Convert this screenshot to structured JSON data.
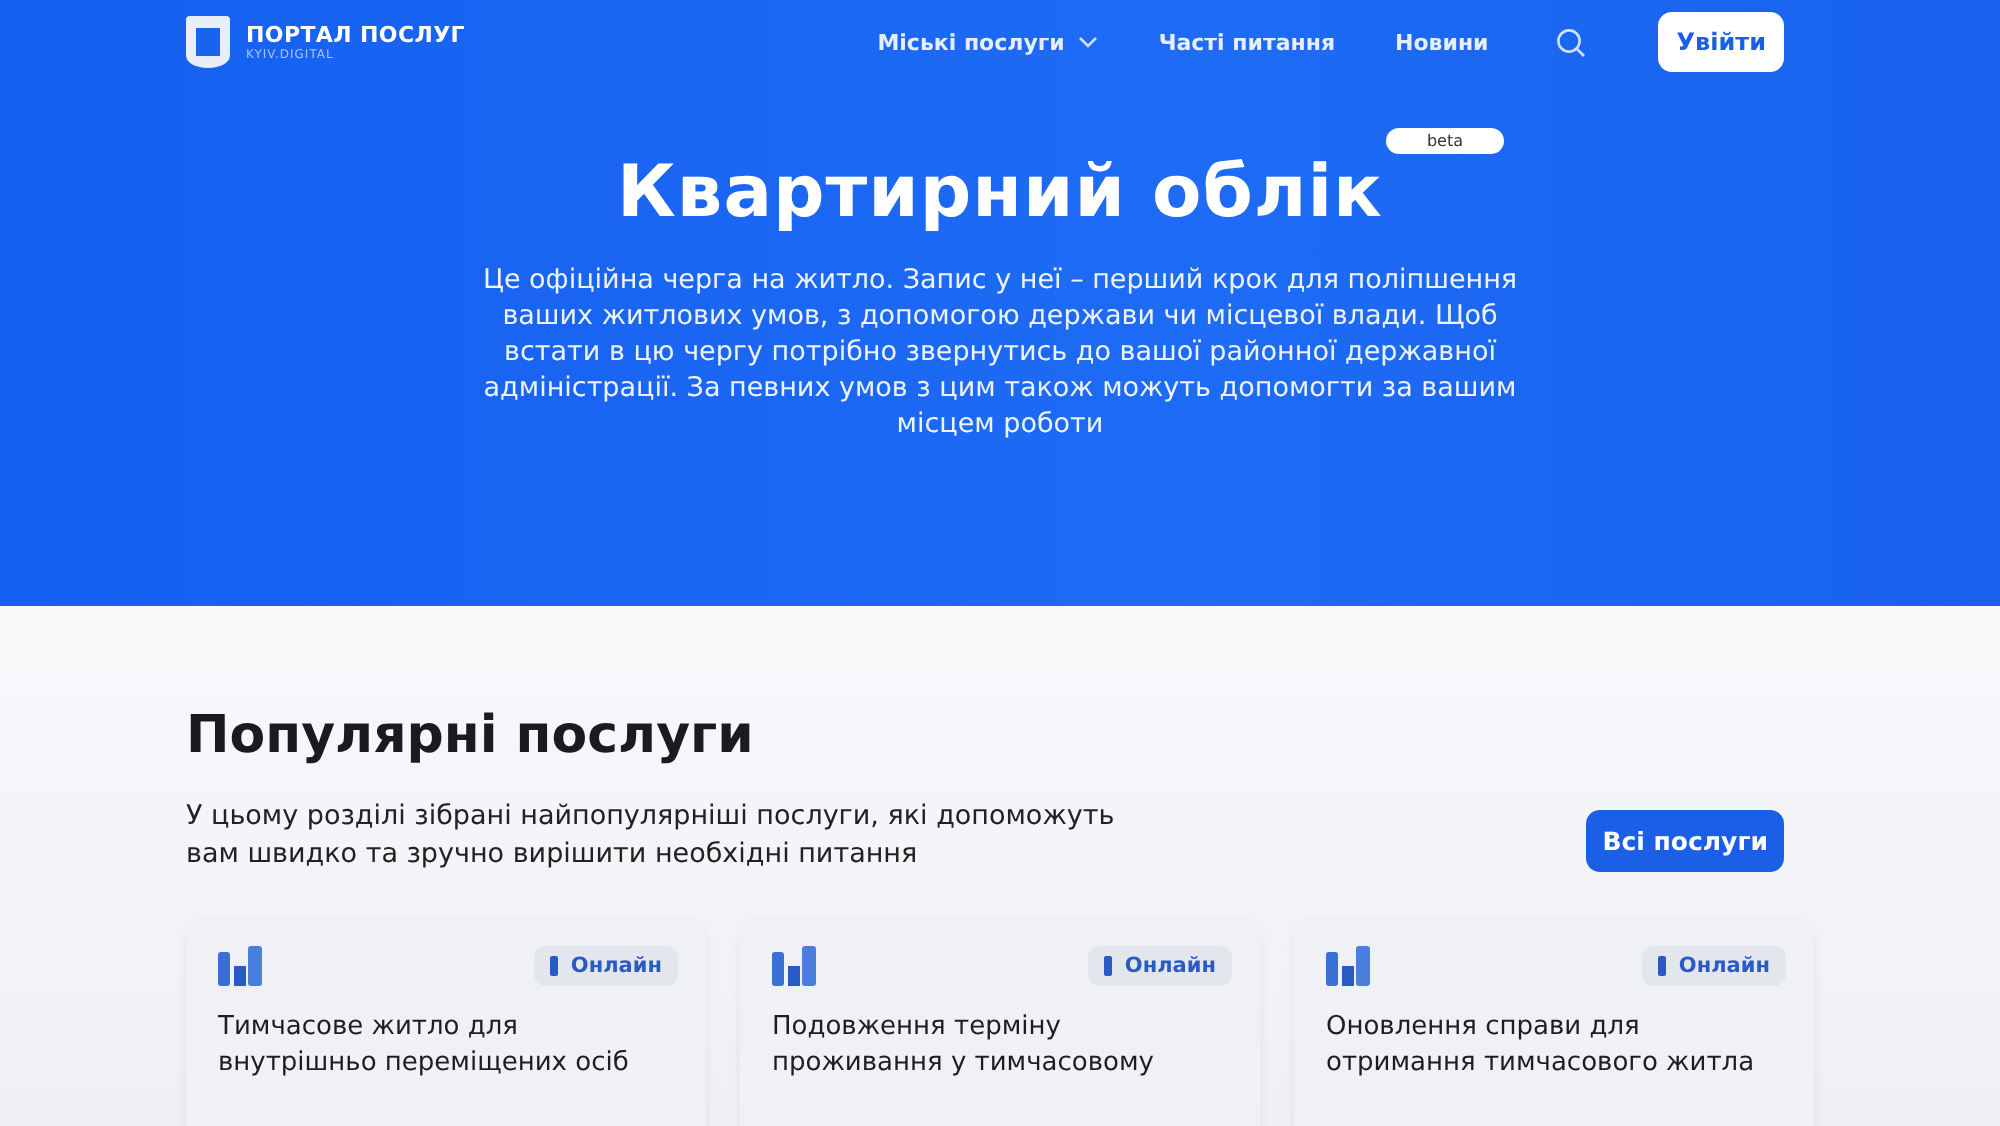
{
  "header": {
    "logo_title": "ПОРТАЛ ПОСЛУГ",
    "logo_subtitle": "KYIV.DIGITAL",
    "nav": [
      {
        "label": "Міські послуги",
        "kind": "dropdown"
      },
      {
        "label": "Часті питання",
        "kind": "link"
      },
      {
        "label": "Новини",
        "kind": "link"
      }
    ],
    "login_button": "Увійти"
  },
  "hero": {
    "badge": "beta",
    "title": "Квартирний облік",
    "description": "Це офіційна черга на житло. Запис у неї – перший крок для поліпшення ваших житлових умов, з допомогою держави чи місцевої влади. Щоб встати в цю чергу потрібно звернутись до вашої районної державної адміністрації. За певних умов з цим також можуть допомогти за вашим місцем роботи"
  },
  "popular": {
    "title": "Популярні послуги",
    "description": "У цьому розділі зібрані найпопулярніші послуги, які допоможуть вам швидко та зручно вирішити необхідні питання",
    "all_button": "Всі послуги",
    "cards": [
      {
        "tag": "Онлайн",
        "title": "Тимчасове житло для внутрішньо переміщених осіб"
      },
      {
        "tag": "Онлайн",
        "title": "Подовження терміну проживання у тимчасовому"
      },
      {
        "tag": "Онлайн",
        "title": "Оновлення справи для отримання тимчасового житла"
      }
    ]
  }
}
